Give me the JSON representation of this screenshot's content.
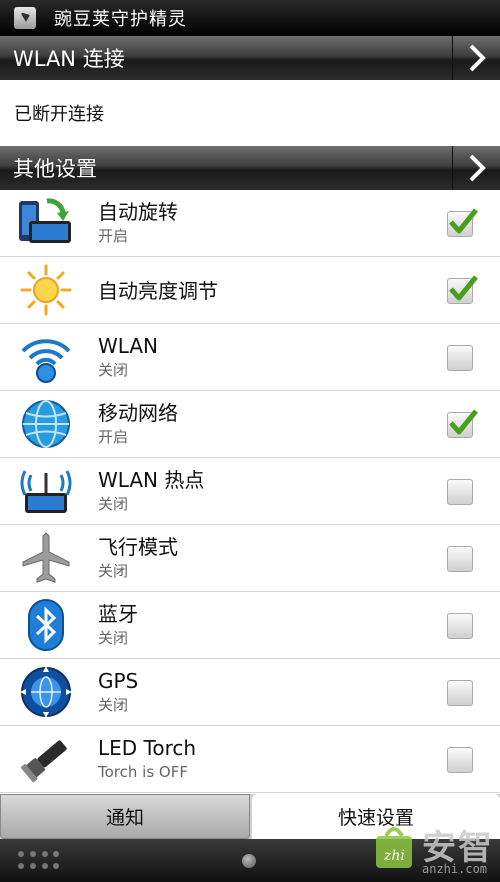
{
  "titlebar": {
    "title": "豌豆荚守护精灵"
  },
  "wlan_section": {
    "label": "WLAN 连接",
    "status": "已断开连接"
  },
  "other_section": {
    "label": "其他设置"
  },
  "settings": [
    {
      "name": "自动旋转",
      "state": "开启",
      "checked": true,
      "icon": "auto-rotate-icon"
    },
    {
      "name": "自动亮度调节",
      "state": "",
      "checked": true,
      "icon": "brightness-icon"
    },
    {
      "name": "WLAN",
      "state": "关闭",
      "checked": false,
      "icon": "wifi-icon"
    },
    {
      "name": "移动网络",
      "state": "开启",
      "checked": true,
      "icon": "globe-icon"
    },
    {
      "name": "WLAN 热点",
      "state": "关闭",
      "checked": false,
      "icon": "hotspot-icon"
    },
    {
      "name": "飞行模式",
      "state": "关闭",
      "checked": false,
      "icon": "airplane-icon"
    },
    {
      "name": "蓝牙",
      "state": "关闭",
      "checked": false,
      "icon": "bluetooth-icon"
    },
    {
      "name": "GPS",
      "state": "关闭",
      "checked": false,
      "icon": "gps-icon"
    },
    {
      "name": "LED Torch",
      "state": "Torch is OFF",
      "checked": false,
      "icon": "torch-icon"
    }
  ],
  "tabs": [
    {
      "label": "通知",
      "active": false
    },
    {
      "label": "快速设置",
      "active": true
    }
  ],
  "watermark": {
    "text": "安智",
    "sub": "anzhi.com"
  },
  "colors": {
    "check_green": "#4a9e1f",
    "header_dark": "#1a1a1a"
  }
}
